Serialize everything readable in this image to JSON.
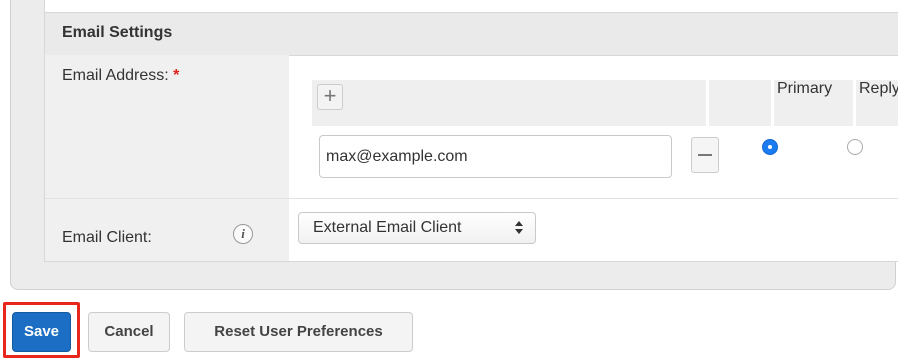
{
  "section": {
    "title": "Email Settings"
  },
  "email_address": {
    "label": "Email Address:",
    "required_marker": "*",
    "add_symbol": "+",
    "columns": {
      "primary": "Primary",
      "reply_to": "Reply-to"
    },
    "entries": [
      {
        "value": "max@example.com",
        "primary": true,
        "reply_to": false
      }
    ]
  },
  "email_client": {
    "label": "Email Client:",
    "info_symbol": "i",
    "selected": "External Email Client"
  },
  "buttons": {
    "save": "Save",
    "cancel": "Cancel",
    "reset": "Reset User Preferences"
  },
  "colors": {
    "save_button": "#1b6ec3",
    "highlight": "#e8261c",
    "radio_selected": "#1b7cf2",
    "required": "#d9251d"
  },
  "icons": {
    "add": "plus-icon",
    "remove": "minus-icon",
    "info": "info-icon",
    "select": "updown-arrows-icon"
  }
}
